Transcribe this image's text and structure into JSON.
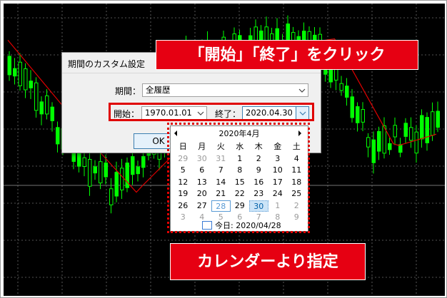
{
  "callouts": {
    "top": "「開始」「終了」をクリック",
    "bottom": "カレンダーより指定"
  },
  "dialog": {
    "title": "期間のカスタム設定",
    "period_label": "期間：",
    "period_value": "全履歴",
    "start_label": "開始：",
    "start_value": "1970.01.01",
    "end_label": "終了：",
    "end_value": "2020.04.30",
    "ok_label": "OK"
  },
  "calendar": {
    "month_title": "2020年4月",
    "weekdays": [
      "日",
      "月",
      "火",
      "水",
      "木",
      "金",
      "土"
    ],
    "weeks": [
      [
        "29",
        "30",
        "31",
        "1",
        "2",
        "3",
        "4"
      ],
      [
        "5",
        "6",
        "7",
        "8",
        "9",
        "10",
        "11"
      ],
      [
        "12",
        "13",
        "14",
        "15",
        "16",
        "17",
        "18"
      ],
      [
        "19",
        "20",
        "21",
        "22",
        "23",
        "24",
        "25"
      ],
      [
        "26",
        "27",
        "28",
        "29",
        "30",
        "1",
        "2"
      ],
      [
        "3",
        "4",
        "5",
        "6",
        "7",
        "8",
        "9"
      ]
    ],
    "today_text": "今日: 2020/04/28"
  },
  "colors": {
    "accent_red": "#e60012",
    "bull_candle": "#00ff00",
    "moving_average": "#e00000",
    "chart_bg": "#000000"
  }
}
